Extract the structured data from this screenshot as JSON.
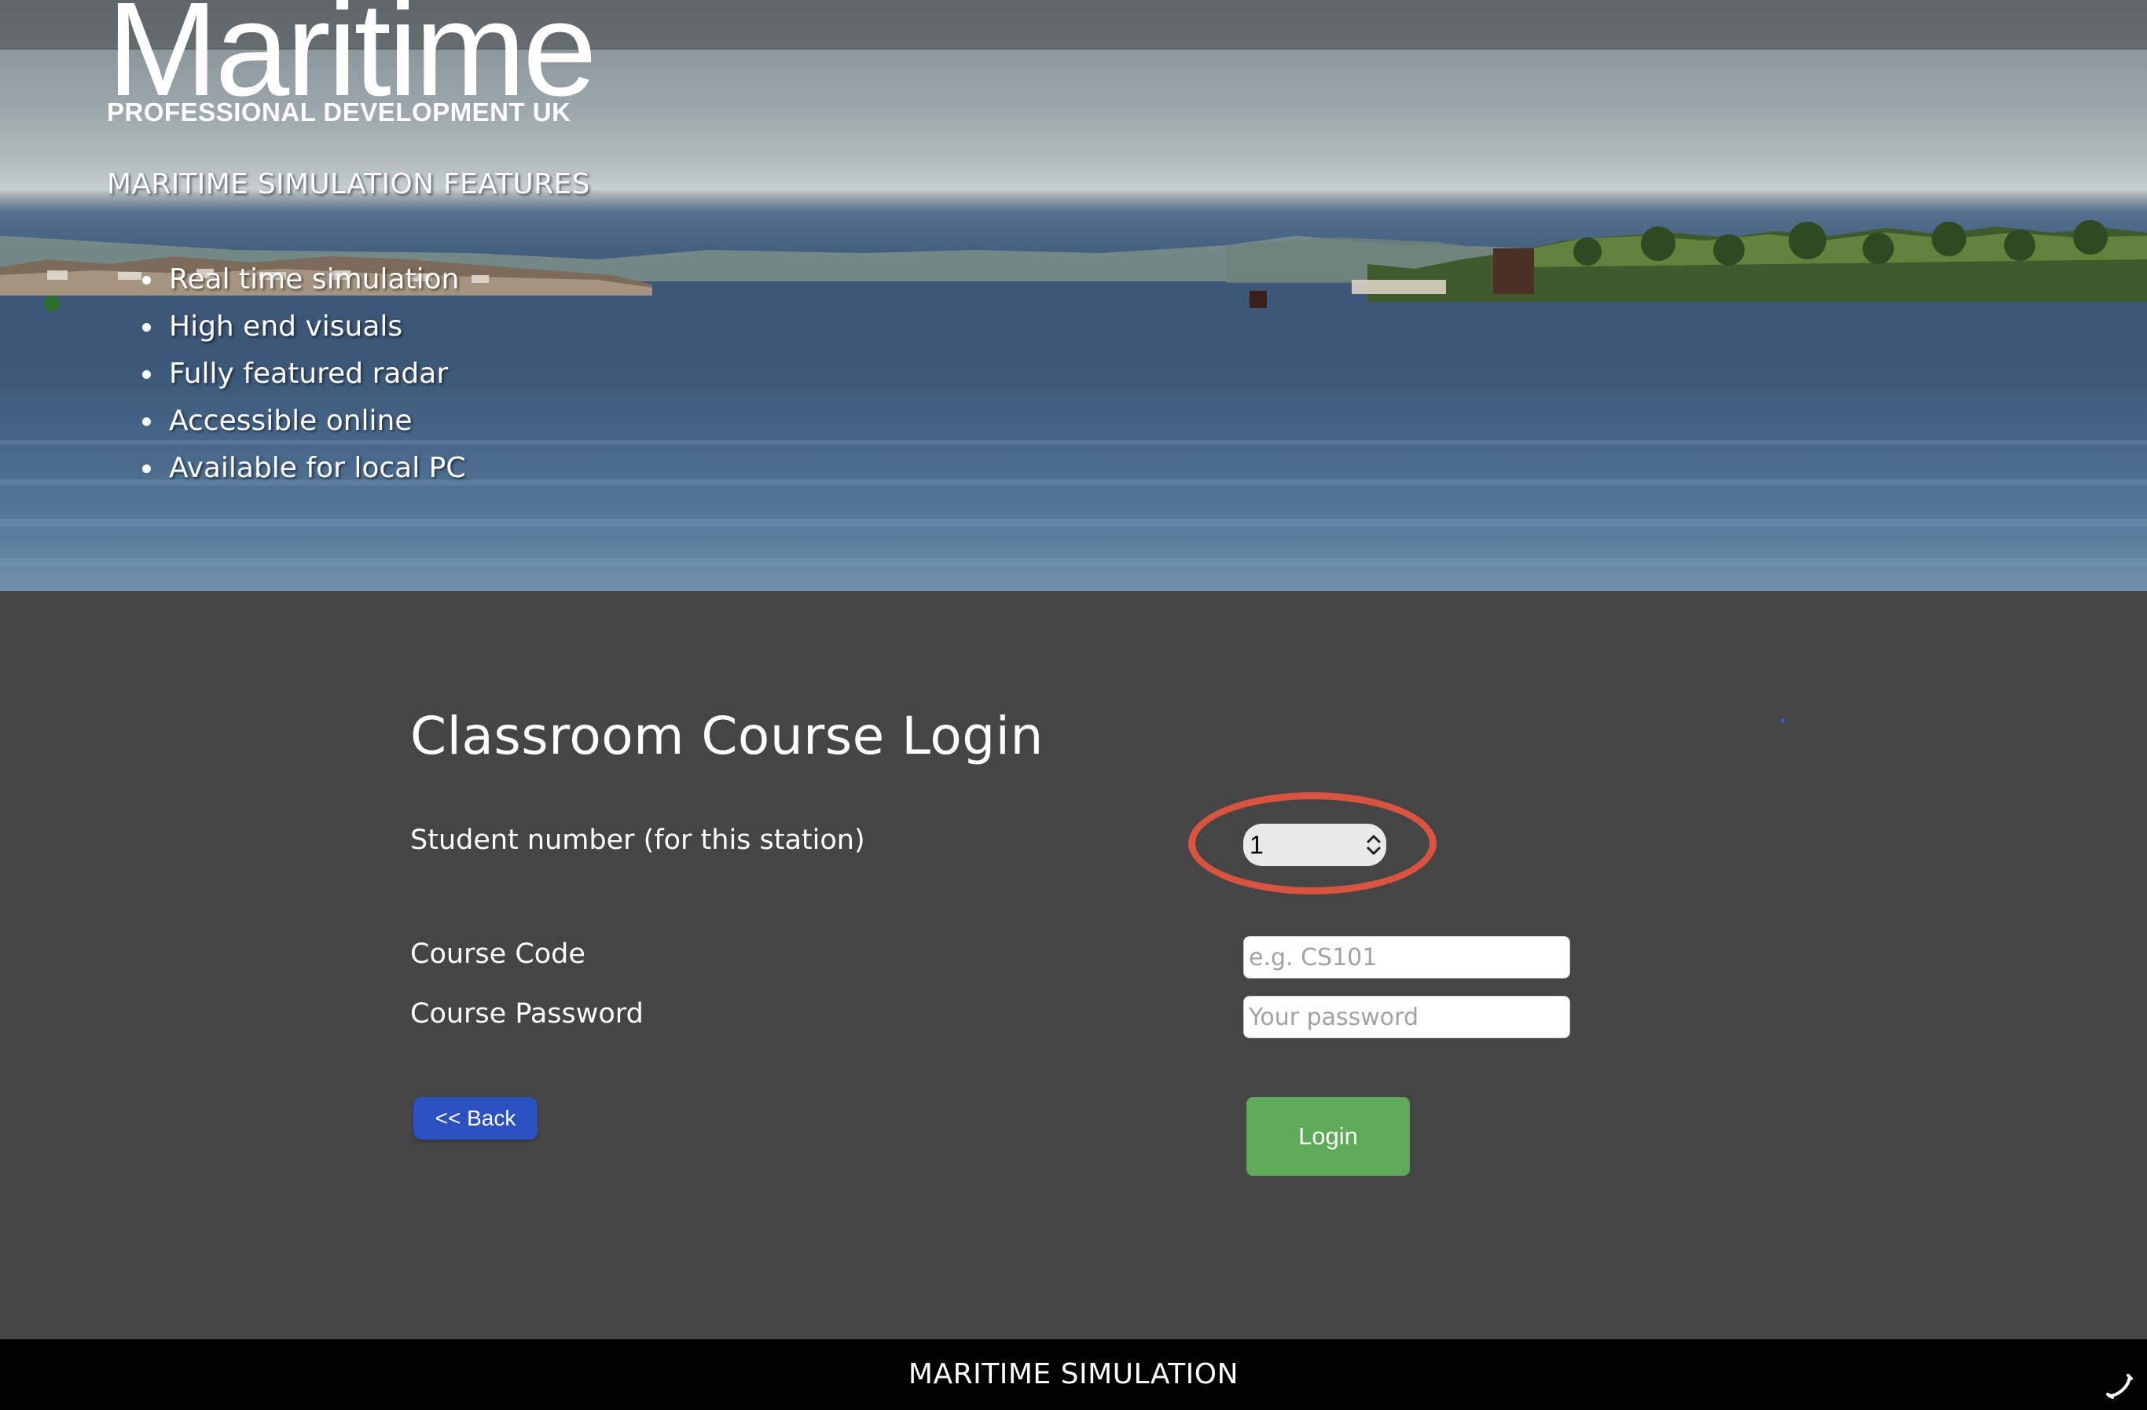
{
  "brand": {
    "name": "Maritime",
    "tagline": "PROFESSIONAL DEVELOPMENT UK"
  },
  "hero": {
    "features_title": "MARITIME SIMULATION FEATURES",
    "features": [
      "Real time simulation",
      "High end visuals",
      "Fully featured radar",
      "Accessible online",
      "Available for local PC"
    ]
  },
  "login": {
    "title": "Classroom Course Login",
    "student_label": "Student number (for this station)",
    "student_value": "1",
    "course_code_label": "Course Code",
    "course_code_placeholder": "e.g. CS101",
    "course_password_label": "Course Password",
    "course_password_placeholder": "Your password",
    "back_label": "<< Back",
    "login_label": "Login"
  },
  "footer": {
    "text": "MARITIME SIMULATION"
  },
  "colors": {
    "page_bg": "#454545",
    "back_button": "#2a4fbf",
    "login_button": "#5ea95a",
    "highlight": "#d9533f",
    "footer_bg": "#000000"
  },
  "icons": {
    "stepper": "chevron-up-down-icon",
    "footer": "phone-icon"
  }
}
